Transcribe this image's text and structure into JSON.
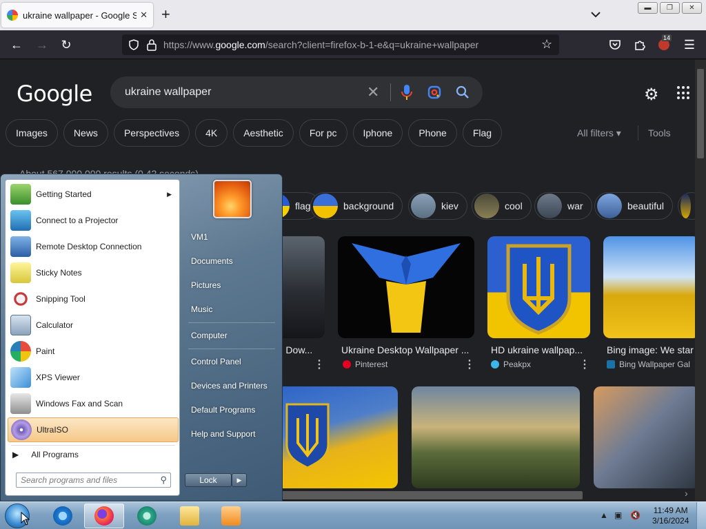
{
  "browser": {
    "tab_title": "ukraine wallpaper - Google Search",
    "url_prefix": "https://www.",
    "url_domain": "google.com",
    "url_rest": "/search?client=firefox-b-1-e&q=ukraine+wallpaper",
    "extension_badge": "14"
  },
  "google": {
    "logo": "Google",
    "query": "ukraine wallpaper",
    "chips": [
      "Images",
      "News",
      "Perspectives",
      "4K",
      "Aesthetic",
      "For pc",
      "Iphone",
      "Phone",
      "Flag"
    ],
    "all_filters": "All filters",
    "tools": "Tools",
    "results_count": "About 567,000,000 results (0.42 seconds)",
    "topic_chips": [
      "flag",
      "background",
      "kiev",
      "cool",
      "war",
      "beautiful"
    ],
    "results": [
      {
        "caption": "s | Dow...",
        "source": ""
      },
      {
        "caption": "Ukraine Desktop Wallpaper ...",
        "source": "Pinterest"
      },
      {
        "caption": "HD ukraine wallpap...",
        "source": "Peakpx"
      },
      {
        "caption": "Bing image: We star",
        "source": "Bing Wallpaper Gal"
      }
    ]
  },
  "start_menu": {
    "programs": [
      {
        "label": "Getting Started",
        "icon": "getting-started-icon",
        "has_submenu": true
      },
      {
        "label": "Connect to a Projector",
        "icon": "projector-icon"
      },
      {
        "label": "Remote Desktop Connection",
        "icon": "remote-desktop-icon"
      },
      {
        "label": "Sticky Notes",
        "icon": "sticky-notes-icon"
      },
      {
        "label": "Snipping Tool",
        "icon": "snipping-tool-icon"
      },
      {
        "label": "Calculator",
        "icon": "calculator-icon"
      },
      {
        "label": "Paint",
        "icon": "paint-icon"
      },
      {
        "label": "XPS Viewer",
        "icon": "xps-viewer-icon"
      },
      {
        "label": "Windows Fax and Scan",
        "icon": "fax-scan-icon"
      },
      {
        "label": "UltraISO",
        "icon": "ultraiso-icon",
        "highlighted": true
      }
    ],
    "all_programs": "All Programs",
    "search_placeholder": "Search programs and files",
    "right_links": [
      "VM1",
      "Documents",
      "Pictures",
      "Music",
      "Computer",
      "Control Panel",
      "Devices and Printers",
      "Default Programs",
      "Help and Support"
    ],
    "lock_label": "Lock"
  },
  "taskbar": {
    "time": "11:49 AM",
    "date": "3/16/2024"
  }
}
